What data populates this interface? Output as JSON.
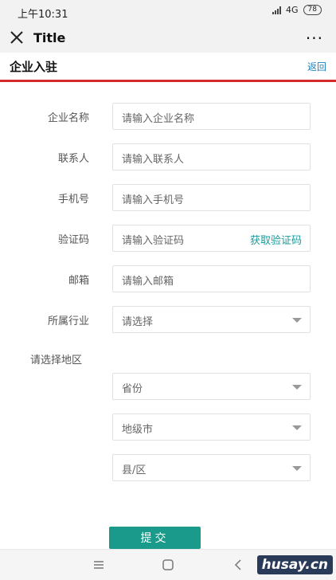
{
  "status": {
    "time": "上午10:31",
    "network": "4G",
    "battery": "78"
  },
  "titlebar": {
    "title": "Title",
    "more": "···"
  },
  "subheader": {
    "heading": "企业入驻",
    "back": "返回"
  },
  "form": {
    "company_label": "企业名称",
    "company_placeholder": "请输入企业名称",
    "contact_label": "联系人",
    "contact_placeholder": "请输入联系人",
    "phone_label": "手机号",
    "phone_placeholder": "请输入手机号",
    "code_label": "验证码",
    "code_placeholder": "请输入验证码",
    "code_link": "获取验证码",
    "email_label": "邮箱",
    "email_placeholder": "请输入邮箱",
    "industry_label": "所属行业",
    "industry_value": "请选择",
    "region_label": "请选择地区",
    "province_value": "省份",
    "city_value": "地级市",
    "district_value": "县/区",
    "submit": "提交"
  },
  "watermark": "husay.cn"
}
